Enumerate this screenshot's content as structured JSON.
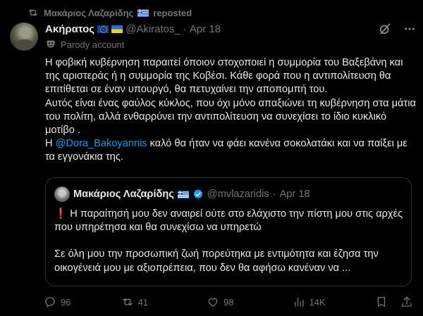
{
  "repost": {
    "user": "Μακάριος Λαζαρίδης",
    "label": "reposted",
    "flag_icon": "greece-flag-icon"
  },
  "tweet": {
    "name": "Ακήρατος",
    "handle": "@Akiratos_",
    "separator": "·",
    "date": "Apr 18",
    "badge": "Parody account",
    "body": {
      "line1": "Η φοβική κυβέρνηση παραιτεί όποιον στοχοποιεί η συμμορία του Βαξεβάνη και της αριστεράς ή η συμμορία της Κοβέσι. Κάθε φορά που η αντιπολίτευση θα επιτίθεται σε έναν υπουργό, θα πετυχαίνει την αποπομπή του.",
      "line2": "Αυτός είναι ένας φαύλος κύκλος, που όχι μόνο απαξιώνει τη κυβέρνηση στα μάτια του πολίτη, αλλά ενθαρρύνει την αντιπολίτευση να συνεχίσει το ίδιο κυκλικό μοτίβο .",
      "line3_pre": "Η ",
      "mention": "@Dora_Bakoyannis",
      "line3_post": " καλό θα ήταν να φάει κανένα σοκολατάκι και να παίξει με τα εγγονάκια της."
    }
  },
  "quoted": {
    "name": "Μακάριος Λαζαρίδης",
    "handle": "@mvlazaridis",
    "separator": "·",
    "date": "Apr 18",
    "exclamation": "❗",
    "para1": "Η παραίτησή μου δεν αναιρεί ούτε στο ελάχιστο την πίστη μου στις αρχές που υπηρέτησα και θα συνεχίσω να υπηρετώ",
    "para2": "Σε όλη μου την προσωπική ζωή πορεύτηκα με εντιμότητα και έζησα την οικογένειά μου με αξιοπρέπεια, που δεν θα αφήσω κανέναν να ..."
  },
  "actions": {
    "replies": "96",
    "reposts": "41",
    "likes": "98",
    "views": "14K"
  },
  "colors": {
    "background": "#000000",
    "text": "#e7e9ea",
    "muted": "#71767b",
    "link": "#1d9bf0",
    "border": "#2f3336",
    "verified": "#1d9bf0"
  }
}
